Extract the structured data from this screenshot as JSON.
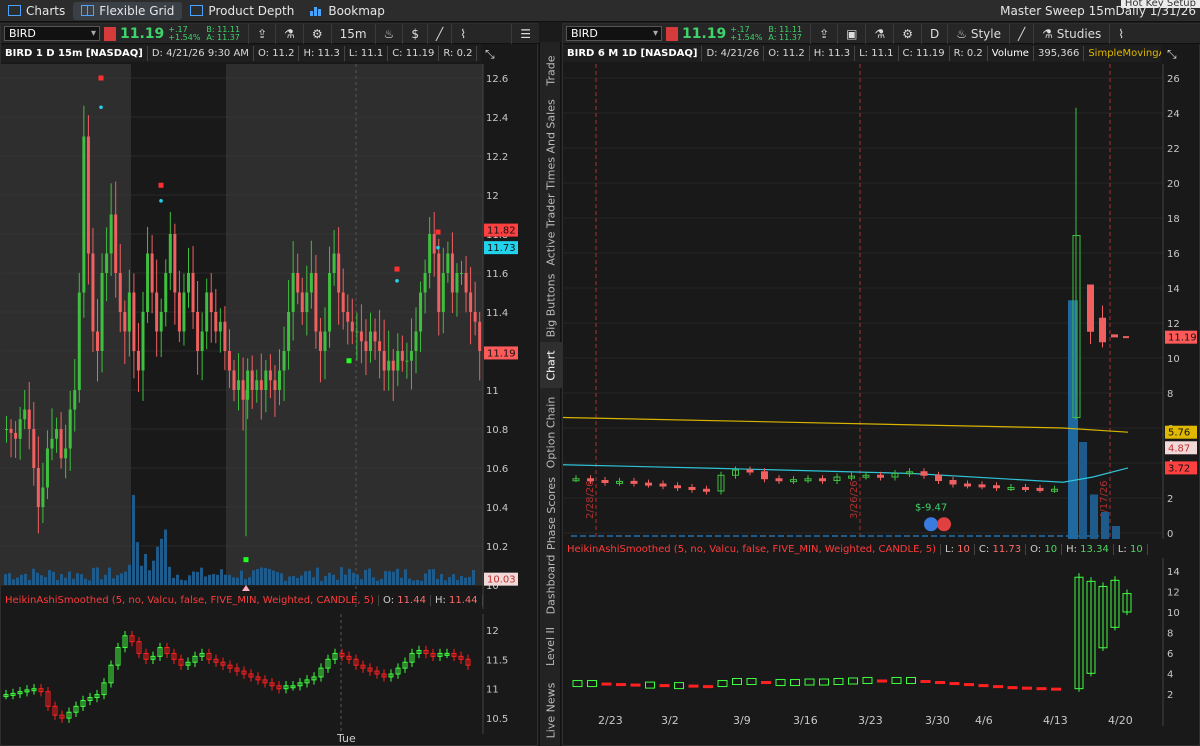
{
  "topnav": {
    "items": [
      {
        "label": "Charts",
        "icon": "chart-icon"
      },
      {
        "label": "Flexible Grid",
        "icon": "grid-icon",
        "active": true
      },
      {
        "label": "Product Depth",
        "icon": "depth-icon"
      },
      {
        "label": "Bookmap",
        "icon": "bookmap-icon"
      }
    ],
    "right_label": "Master Sweep 15mDaily 1/31/26",
    "hotkey_label": "Hot Key Setup"
  },
  "left": {
    "symbol": "BIRD",
    "last": "11.19",
    "change": "+.17",
    "change_pct": "+1.54%",
    "bid": "B: 11.11",
    "ask": "A: 11.37",
    "timeframe": "15m",
    "info": {
      "title": "BIRD 1 D 15m [NASDAQ]",
      "date": "D: 4/21/26 9:30 AM",
      "open": "O: 11.2",
      "high": "H: 11.3",
      "low": "L: 11.1",
      "close": "C: 11.19",
      "range": "R: 0.2",
      "more": "..."
    },
    "price_axis": [
      "12.6",
      "12.4",
      "12.2",
      "12",
      "11.8",
      "11.6",
      "11.4",
      "11.2",
      "11",
      "10.8",
      "10.6",
      "10.4",
      "10.2",
      "10"
    ],
    "price_labels": [
      {
        "value": "11.82",
        "color": "#ff4040"
      },
      {
        "value": "11.73",
        "color": "#22d3ee"
      },
      {
        "value": "11.19",
        "color": "#ff5a5a"
      },
      {
        "value": "10.03",
        "color": "#ff9a9a"
      }
    ],
    "indicator": {
      "name": "HeikinAshiSmoothed (5, no, Valcu, false, FIVE_MIN, Weighted, CANDLE, 5)",
      "open": "11.44",
      "high": "11.44",
      "o_prefix": "O:",
      "h_prefix": "H:"
    },
    "ind_axis": [
      "12",
      "11.5",
      "11",
      "10.5"
    ],
    "x_label": "Tue"
  },
  "right": {
    "symbol": "BIRD",
    "last": "11.19",
    "change": "+.17",
    "change_pct": "+1.54%",
    "bid": "B: 11.11",
    "ask": "A: 11.37",
    "timeframe": "D",
    "style_label": "Style",
    "studies_label": "Studies",
    "info": {
      "title": "BIRD 6 M 1D [NASDAQ]",
      "date": "D: 4/21/26",
      "open": "O: 11.2",
      "high": "H: 11.3",
      "low": "L: 11.1",
      "close": "C: 11.19",
      "range": "R: 0.2",
      "volume_label": "Volume",
      "volume": "395,366",
      "sma": "SimpleMovingAvg ..."
    },
    "price_axis": [
      "26",
      "24",
      "22",
      "20",
      "18",
      "16",
      "14",
      "12",
      "10",
      "8",
      "6",
      "4",
      "2",
      "0"
    ],
    "price_labels": [
      {
        "value": "11.19",
        "color": "#ff5a5a"
      },
      {
        "value": "5.76",
        "color": "#e0b800"
      },
      {
        "value": "4.87",
        "color": "#ff9a9a"
      },
      {
        "value": "3.72",
        "color": "#ff4040"
      }
    ],
    "event_label": "$-9.47",
    "vlines": [
      "2/28/26",
      "3/26/26",
      "4/17/26"
    ],
    "indicator": {
      "name": "HeikinAshiSmoothed (5, no, Valcu, false, FIVE_MIN, Weighted, CANDLE, 5)",
      "low": "10",
      "close": "11.73",
      "open": "10",
      "high": "13.34",
      "low2": "10",
      "l_prefix": "L:",
      "c_prefix": "C:",
      "o_prefix": "O:",
      "h_prefix": "H:"
    },
    "ind_axis": [
      "14",
      "12",
      "10",
      "8",
      "6",
      "4",
      "2"
    ],
    "x_labels": [
      "2/23",
      "3/2",
      "3/9",
      "3/16",
      "3/23",
      "3/30",
      "4/6",
      "4/13",
      "4/20"
    ]
  },
  "sidetabs": [
    "Trade",
    "Times And Sales",
    "Active Trader",
    "Big Buttons",
    "Chart",
    "Option Chain",
    "Phase Scores",
    "Dashboard",
    "Level II",
    "Live News"
  ],
  "active_tab": "Chart",
  "colors": {
    "up": "#3fbf3f",
    "down": "#f06060",
    "volume": "#1e5a8a",
    "sma_slow": "#d8b400",
    "sma_fast": "#2fc4d8",
    "ha_up": "#40ff40",
    "ha_down": "#ff2020"
  }
}
